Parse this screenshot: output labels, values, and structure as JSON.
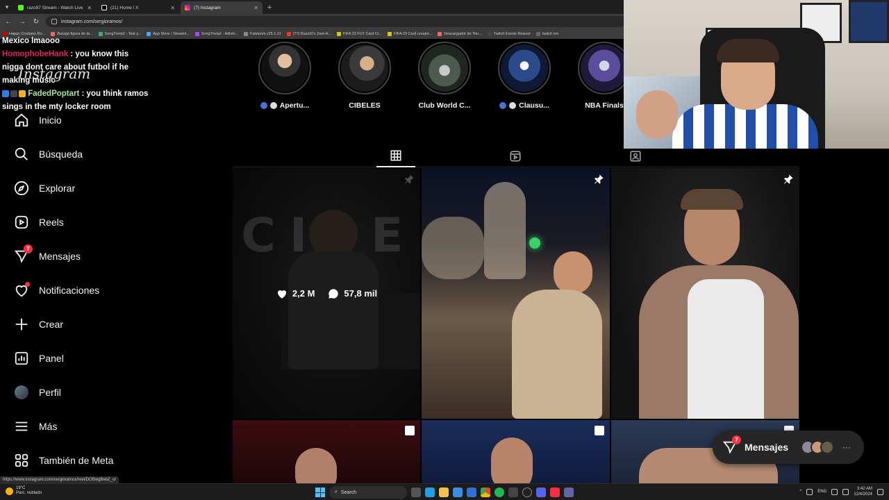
{
  "browser": {
    "tabs": [
      {
        "title": "razo97 Stream - Watch Live on",
        "color": "#53fc18",
        "active": false
      },
      {
        "title": "(21) Home / X",
        "color": "#ffffff",
        "active": false
      },
      {
        "title": "(7) Instagram",
        "color": "#e1306c",
        "active": true
      }
    ],
    "new_tab": "+",
    "url": "instagram.com/sergioramos/",
    "bookmarks": [
      "Happy Cristiano Ro...",
      "Buraqo figura de ta...",
      "SongTrivia2 - Test y...",
      "App Store / Streami...",
      "SongTrivia2 - Adivin...",
      "Faletools v25.1.11",
      "(77) Razo97s Zest-A...",
      "FIFA 23 FUT Card Cr...",
      "FIFA 23 Card creator...",
      "Descargador de You...",
      "Twitch Emote Resizer",
      "twitch em"
    ]
  },
  "stream_chat": [
    {
      "user": "",
      "text": "Mexico lmaooo",
      "user_style": ""
    },
    {
      "user": "HomophobeHank",
      "text": " : you know this nigga dont care about futbol if he making music",
      "user_style": "chat-user"
    },
    {
      "user": "FadedPoptart",
      "text": " : you think ramos sings in the mty locker room",
      "user_style": "chat-user2"
    }
  ],
  "sidebar": {
    "logo": "Instagram",
    "items": [
      {
        "label": "Inicio",
        "icon": "home-icon"
      },
      {
        "label": "Búsqueda",
        "icon": "search-icon"
      },
      {
        "label": "Explorar",
        "icon": "compass-icon"
      },
      {
        "label": "Reels",
        "icon": "reels-icon"
      },
      {
        "label": "Mensajes",
        "icon": "messenger-icon",
        "badge": "7"
      },
      {
        "label": "Notificaciones",
        "icon": "heart-icon"
      },
      {
        "label": "Crear",
        "icon": "plus-icon"
      },
      {
        "label": "Panel",
        "icon": "chart-icon"
      },
      {
        "label": "Perfil",
        "icon": "avatar"
      },
      {
        "label": "Más",
        "icon": "menu-icon"
      },
      {
        "label": "También de Meta",
        "icon": "grid-icon"
      }
    ]
  },
  "stories": [
    {
      "label": "Apertu...",
      "color": "#5a6a78"
    },
    {
      "label": "CIBELES",
      "color": "#8a7a60"
    },
    {
      "label": "Club World C...",
      "color": "#4a5a4a"
    },
    {
      "label": "Clausu...",
      "color": "#2a4a8a"
    },
    {
      "label": "NBA Finals",
      "color": "#6a5a9a"
    }
  ],
  "posts": {
    "hover_likes": "2,2 M",
    "hover_comments": "57,8 mil",
    "cibeles_word": "CIBELES"
  },
  "messages_pill": {
    "label": "Mensajes",
    "badge": "7",
    "more": "···"
  },
  "status_url": "https://www.instagram.com/sergioramos/reel/DOBwgBebZ_o/",
  "taskbar": {
    "temperature": "19°C",
    "weather": "Parc. nublado",
    "search": "Search",
    "lang": "ENG",
    "time": "3:42 AM",
    "date": "12/4/2024"
  }
}
